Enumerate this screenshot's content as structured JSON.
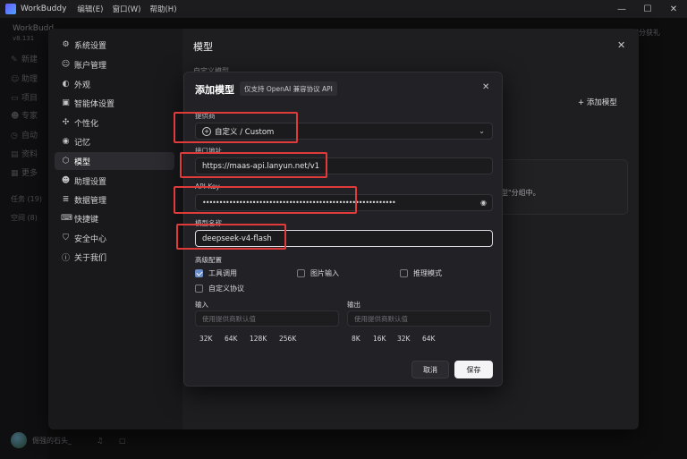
{
  "titlebar": {
    "app_name": "WorkBuddy",
    "menus": [
      "编辑(E)",
      "窗口(W)",
      "帮助(H)"
    ],
    "minimize": "—",
    "maximize": "☐",
    "close": "✕"
  },
  "background": {
    "workspace": "WorkBudd",
    "version": "v8.131",
    "items": [
      "新建",
      "助理",
      "项目",
      "专家",
      "自动",
      "资料",
      "更多"
    ],
    "task_label": "任务 (19)",
    "empty_label": "空间 (8)",
    "right_label": "积分获礼",
    "user_name": "倔强的石头_"
  },
  "settings": {
    "nav": [
      {
        "icon": "gear-icon",
        "glyph": "⚙",
        "label": "系统设置"
      },
      {
        "icon": "user-icon",
        "glyph": "☺",
        "label": "账户管理"
      },
      {
        "icon": "palette-icon",
        "glyph": "◐",
        "label": "外观"
      },
      {
        "icon": "bot-icon",
        "glyph": "▣",
        "label": "智能体设置"
      },
      {
        "icon": "sparkle-icon",
        "glyph": "✣",
        "label": "个性化"
      },
      {
        "icon": "pin-icon",
        "glyph": "◉",
        "label": "记忆"
      },
      {
        "icon": "cube-icon",
        "glyph": "⬡",
        "label": "模型"
      },
      {
        "icon": "assistant-icon",
        "glyph": "☻",
        "label": "助理设置"
      },
      {
        "icon": "database-icon",
        "glyph": "≣",
        "label": "数据管理"
      },
      {
        "icon": "keyboard-icon",
        "glyph": "⌨",
        "label": "快捷键"
      },
      {
        "icon": "shield-icon",
        "glyph": "⛉",
        "label": "安全中心"
      },
      {
        "icon": "info-icon",
        "glyph": "ⓘ",
        "label": "关于我们"
      }
    ],
    "active_index": 6,
    "title": "模型",
    "close": "✕",
    "subtitle": "自定义模型",
    "add_model": "+ 添加模型",
    "card_hint": "型\"分组中。"
  },
  "modal": {
    "title": "添加模型",
    "badge": "仅支持 OpenAI 兼容协议 API",
    "close": "✕",
    "provider_label": "提供商",
    "provider_value": "自定义 / Custom",
    "endpoint_label": "接口地址",
    "endpoint_value": "https://maas-api.lanyun.net/v1",
    "apikey_label": "API Key",
    "apikey_value": "••••••••••••••••••••••••••••••••••••••••••••••••••••••••••",
    "model_label": "模型名称",
    "model_value": "deepseek-v4-flash",
    "advanced_label": "高级配置",
    "options": [
      {
        "label": "工具调用",
        "checked": true
      },
      {
        "label": "图片输入",
        "checked": false
      },
      {
        "label": "推理模式",
        "checked": false
      },
      {
        "label": "自定义协议",
        "checked": false
      }
    ],
    "input_label": "输入",
    "output_label": "输出",
    "input_placeholder": "使用提供商默认值",
    "output_placeholder": "使用提供商默认值",
    "input_presets": [
      "32K",
      "64K",
      "128K",
      "256K"
    ],
    "output_presets": [
      "8K",
      "16K",
      "32K",
      "64K"
    ],
    "cancel": "取消",
    "save": "保存"
  }
}
